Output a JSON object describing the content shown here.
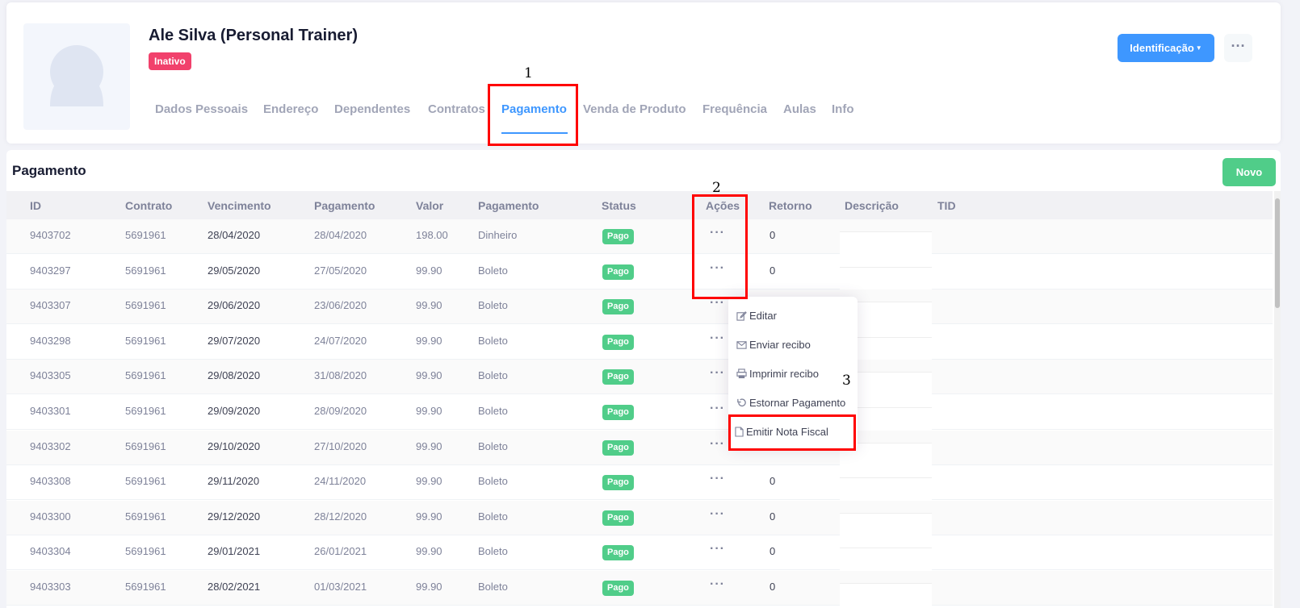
{
  "profile": {
    "name": "Ale Silva (Personal Trainer)",
    "status": "Inativo",
    "ident_button": "Identificação",
    "more_button": "···"
  },
  "tabs": [
    {
      "label": "Dados Pessoais",
      "active": false
    },
    {
      "label": "Endereço",
      "active": false
    },
    {
      "label": "Dependentes",
      "active": false
    },
    {
      "label": "Contratos",
      "active": false
    },
    {
      "label": "Pagamento",
      "active": true
    },
    {
      "label": "Venda de Produto",
      "active": false
    },
    {
      "label": "Frequência",
      "active": false
    },
    {
      "label": "Aulas",
      "active": false
    },
    {
      "label": "Info",
      "active": false
    }
  ],
  "section": {
    "title": "Pagamento",
    "new_button": "Novo"
  },
  "table": {
    "headers": [
      "ID",
      "Contrato",
      "Vencimento",
      "Pagamento",
      "Valor",
      "Pagamento",
      "Status",
      "Ações",
      "Retorno",
      "Descrição",
      "TID"
    ],
    "rows": [
      {
        "id": "9403702",
        "contrato": "5691961",
        "vencimento": "28/04/2020",
        "pagamento": "28/04/2020",
        "valor": "198.00",
        "forma": "Dinheiro",
        "status": "Pago",
        "acoes": "···",
        "retorno": "0"
      },
      {
        "id": "9403297",
        "contrato": "5691961",
        "vencimento": "29/05/2020",
        "pagamento": "27/05/2020",
        "valor": "99.90",
        "forma": "Boleto",
        "status": "Pago",
        "acoes": "···",
        "retorno": "0"
      },
      {
        "id": "9403307",
        "contrato": "5691961",
        "vencimento": "29/06/2020",
        "pagamento": "23/06/2020",
        "valor": "99.90",
        "forma": "Boleto",
        "status": "Pago",
        "acoes": "···",
        "retorno": ""
      },
      {
        "id": "9403298",
        "contrato": "5691961",
        "vencimento": "29/07/2020",
        "pagamento": "24/07/2020",
        "valor": "99.90",
        "forma": "Boleto",
        "status": "Pago",
        "acoes": "···",
        "retorno": ""
      },
      {
        "id": "9403305",
        "contrato": "5691961",
        "vencimento": "29/08/2020",
        "pagamento": "31/08/2020",
        "valor": "99.90",
        "forma": "Boleto",
        "status": "Pago",
        "acoes": "···",
        "retorno": ""
      },
      {
        "id": "9403301",
        "contrato": "5691961",
        "vencimento": "29/09/2020",
        "pagamento": "28/09/2020",
        "valor": "99.90",
        "forma": "Boleto",
        "status": "Pago",
        "acoes": "···",
        "retorno": ""
      },
      {
        "id": "9403302",
        "contrato": "5691961",
        "vencimento": "29/10/2020",
        "pagamento": "27/10/2020",
        "valor": "99.90",
        "forma": "Boleto",
        "status": "Pago",
        "acoes": "···",
        "retorno": ""
      },
      {
        "id": "9403308",
        "contrato": "5691961",
        "vencimento": "29/11/2020",
        "pagamento": "24/11/2020",
        "valor": "99.90",
        "forma": "Boleto",
        "status": "Pago",
        "acoes": "···",
        "retorno": "0"
      },
      {
        "id": "9403300",
        "contrato": "5691961",
        "vencimento": "29/12/2020",
        "pagamento": "28/12/2020",
        "valor": "99.90",
        "forma": "Boleto",
        "status": "Pago",
        "acoes": "···",
        "retorno": "0"
      },
      {
        "id": "9403304",
        "contrato": "5691961",
        "vencimento": "29/01/2021",
        "pagamento": "26/01/2021",
        "valor": "99.90",
        "forma": "Boleto",
        "status": "Pago",
        "acoes": "···",
        "retorno": "0"
      },
      {
        "id": "9403303",
        "contrato": "5691961",
        "vencimento": "28/02/2021",
        "pagamento": "01/03/2021",
        "valor": "99.90",
        "forma": "Boleto",
        "status": "Pago",
        "acoes": "···",
        "retorno": "0"
      }
    ]
  },
  "dropdown": {
    "items": [
      {
        "label": "Editar",
        "icon": "edit-icon"
      },
      {
        "label": "Enviar recibo",
        "icon": "envelope-icon"
      },
      {
        "label": "Imprimir recibo",
        "icon": "printer-icon"
      },
      {
        "label": "Estornar Pagamento",
        "icon": "undo-icon"
      },
      {
        "label": "Emitir Nota Fiscal",
        "icon": "file-icon"
      }
    ]
  },
  "annotations": [
    "1",
    "2",
    "3"
  ],
  "colors": {
    "accent": "#3e97ff",
    "success": "#50cd89",
    "danger": "#f1416c",
    "annotation": "#ff0000"
  }
}
